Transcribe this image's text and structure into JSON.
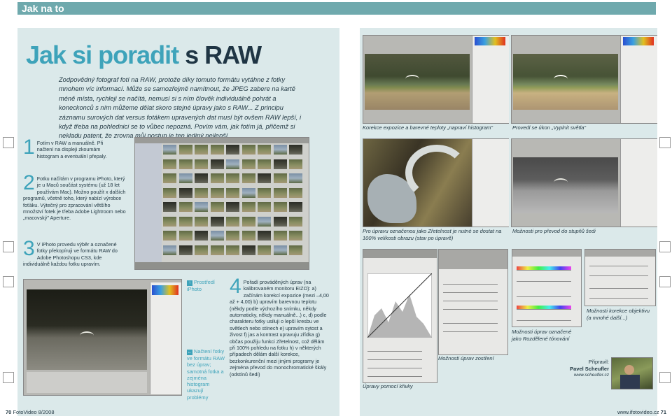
{
  "banner": {
    "label": "Jak na to"
  },
  "article": {
    "title_part1": "Jak si poradit",
    "title_part2": "s RAW",
    "intro": "Zodpovědný fotograf fotí na RAW, protože díky tomuto formátu vytáhne z fotky mnohem víc informací. Může se samozřejmě namítnout, že JPEG zabere na kartě méně místa, rychleji se načítá, nemusí si s ním člověk individuálně pohrát a koneckonců s ním můžeme dělat skoro stejné úpravy jako s RAW... Z principu záznamu surových dat versus fotákem upravených dat musí být ovšem RAW lepší, i když třeba na pohlednici se to vůbec nepozná. Povím vám, jak fotím já, přičemž si nekladu patent, že zrovna můj postup je ten jediný nejlepší."
  },
  "steps": [
    {
      "num": "1",
      "text": "Fotím v RAW a manuálně. Při načtení na displeji zkoumám histogram a eventuální přepaly."
    },
    {
      "num": "2",
      "text": "Fotku načítám v programu iPhoto, který je u Maců součást systému (už 18 let používám Mac). Možno použít x dalších programů, včetně toho, který nabízí výrobce foťáku. Výtečný pro zpracování většího množství fotek je třeba Adobe Lightroom nebo „macovský\" Aperture."
    },
    {
      "num": "3",
      "text": "V iPhoto provedu výběr a označené fotky překopíruji ve formátu RAW do Adobe Photoshopu CS3, kde individuálně každou fotku upravím."
    },
    {
      "num": "4",
      "text": "Pořadí prováděných úprav (na kalibrovaném monitoru EIZO): a) začínám korekcí expozice (mezi –4,00 až + 4,00) b) upravím barevnou teplotu (někdy podle výchozího snímku, někdy automaticky, někdy manuálně...) c, d) podle charakteru fotky usiluji o lepší kresbu ve světlech nebo stínech e) upravím sytost a živost f) jas a kontrast upravuju zřídka g) občas použiju funkci Zřetelnost, což dělám při 100% pohledu na fotku h) v některých případech dělám další korekce, bezkonkurenční mezi jinými programy je zejména převod do monochromatické škály (odstínů šedi)"
    }
  ],
  "left_captions": [
    {
      "icon": "↑",
      "text": "Prostředí iPhoto"
    },
    {
      "icon": "←",
      "text": "Načtení fotky ve formátu RAW bez úprav; samotná fotka a zejména histogram ukazují problémy"
    }
  ],
  "right_captions": {
    "c1": "Korekce expozice a barevné teploty „napraví histogram\"",
    "c2": "Provedl se úkon „Vyplnit světla\"",
    "c3": "Pro úpravu označenou jako Zřetelnost je nutné se dostat na 100% velikosti obrazu (stav po úpravě)",
    "c4": "Možnosti pro převod do stupňů šedi",
    "c5": "Možnosti korekce objektivu (a mnohé další...)",
    "c6": "Možnosti úprav označené jako Rozdělené tónování",
    "c7": "Možnosti úprav zostření",
    "c8": "Úpravy pomocí křivky"
  },
  "credit": {
    "label": "Připravil:",
    "name": "Pavel Scheufler",
    "url": "www.scheufler.cz"
  },
  "footer": {
    "left_page": "70",
    "left_mag": "FotoVideo 8/2008",
    "right_url": "www.ifotovideo.cz",
    "right_page": "71"
  }
}
